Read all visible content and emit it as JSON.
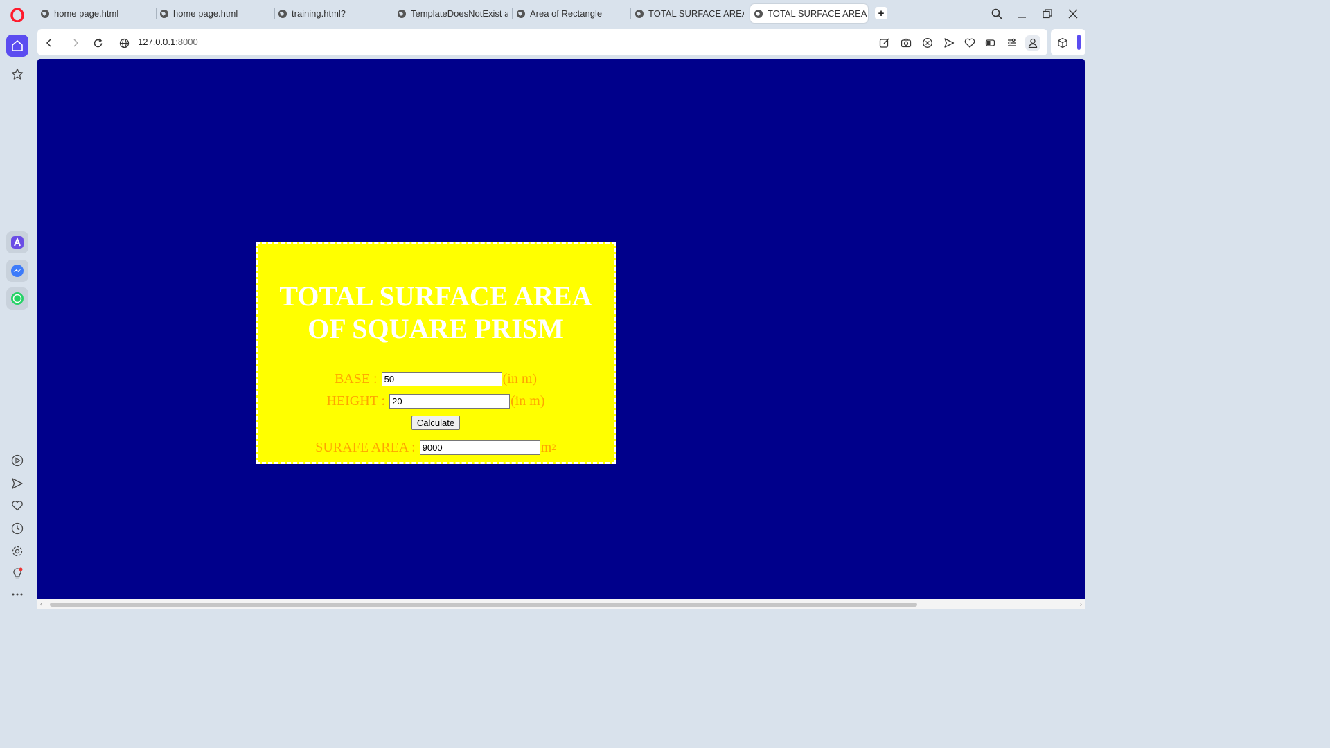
{
  "browser": {
    "tabs": [
      {
        "label": "home page.html",
        "active": false
      },
      {
        "label": "home page.html",
        "active": false
      },
      {
        "label": "training.html?",
        "active": false
      },
      {
        "label": "TemplateDoesNotExist at",
        "active": false
      },
      {
        "label": "Area of Rectangle",
        "active": false
      },
      {
        "label": "TOTAL SURFACE AREA OF",
        "active": false
      },
      {
        "label": "TOTAL SURFACE AREA OF",
        "active": true
      }
    ],
    "address": {
      "host": "127.0.0.1",
      "port": ":8000"
    }
  },
  "page": {
    "title": "TOTAL SURFACE AREA OF SQUARE PRISM",
    "base_label": "BASE :",
    "base_value": "50",
    "base_unit": "(in m)",
    "height_label": "HEIGHT :",
    "height_value": "20",
    "height_unit": "(in m)",
    "calculate_label": "Calculate",
    "area_label": "SURAFE AREA :",
    "area_value": "9000",
    "area_unit": "m",
    "area_unit_exp": "2"
  },
  "colors": {
    "background": "#00008b",
    "card": "#ffff00",
    "label": "#ffa500",
    "heading": "#ffffff",
    "accent": "#5b4cf0"
  },
  "icons": {
    "sidebar": [
      "opera-logo-icon",
      "home-icon",
      "star-icon",
      "aria-icon",
      "messenger-icon",
      "whatsapp-icon",
      "player-icon",
      "send-icon",
      "heart-icon",
      "history-icon",
      "settings-icon",
      "tips-icon",
      "more-icon"
    ],
    "toolbar": [
      "snapshot-edit-icon",
      "camera-icon",
      "adblock-icon",
      "send-icon",
      "heart-icon",
      "battery-icon",
      "easy-setup-icon",
      "profile-icon",
      "extensions-icon"
    ]
  }
}
